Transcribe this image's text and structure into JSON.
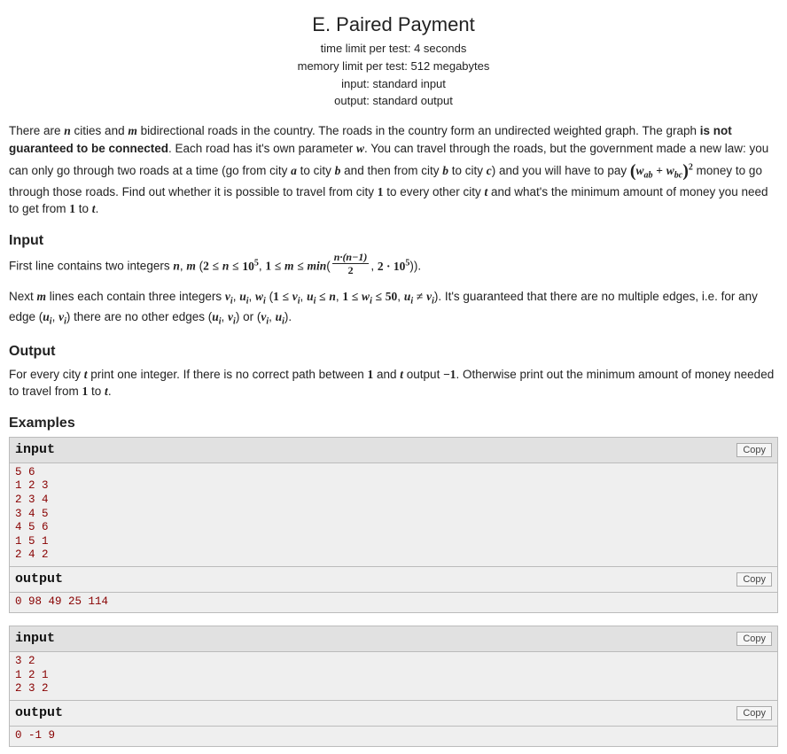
{
  "header": {
    "title": "E. Paired Payment",
    "time_limit": "time limit per test: 4 seconds",
    "memory_limit": "memory limit per test: 512 megabytes",
    "input": "input: standard input",
    "output": "output: standard output"
  },
  "sections": {
    "input_title": "Input",
    "output_title": "Output",
    "examples_title": "Examples"
  },
  "labels": {
    "input": "input",
    "output": "output",
    "copy": "Copy"
  },
  "examples": [
    {
      "input": "5 6\n1 2 3\n2 3 4\n3 4 5\n4 5 6\n1 5 1\n2 4 2",
      "output": "0 98 49 25 114"
    },
    {
      "input": "3 2\n1 2 1\n2 3 2",
      "output": "0 -1 9"
    }
  ]
}
